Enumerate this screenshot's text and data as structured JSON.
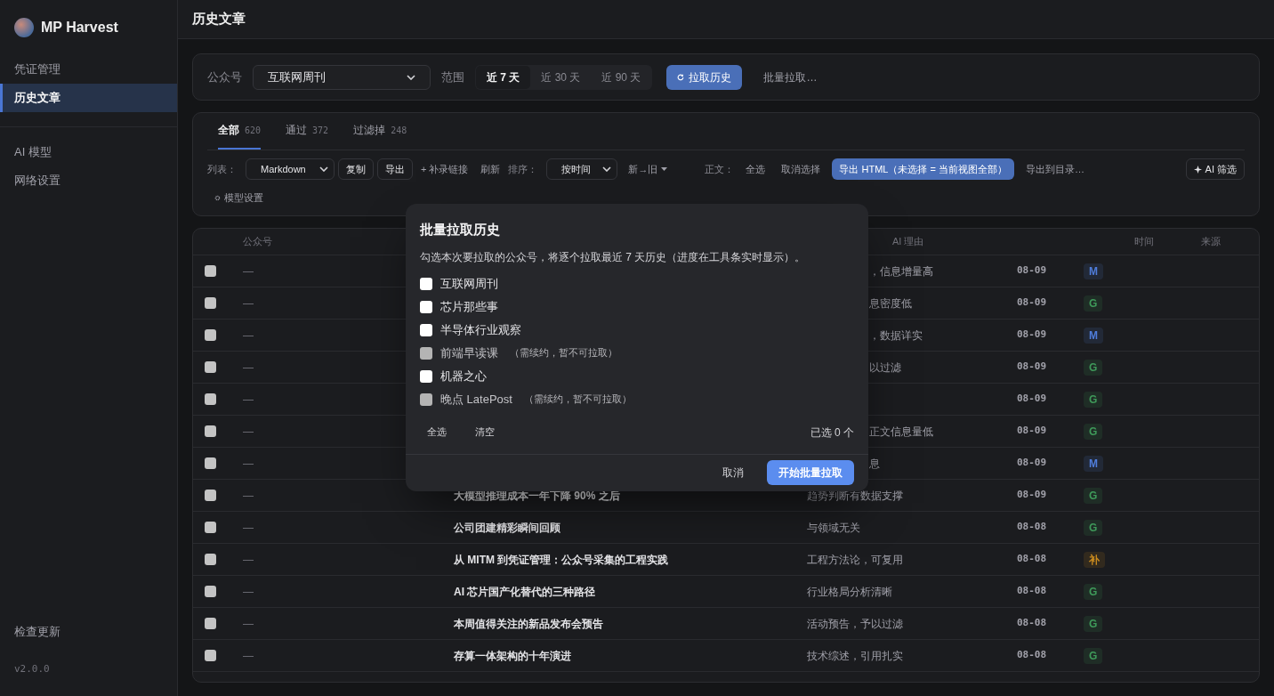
{
  "app": {
    "name": "MP Harvest",
    "version": "v2.0.0"
  },
  "sidebar": {
    "groups": [
      {
        "items": [
          {
            "label": "凭证管理",
            "selected": false
          },
          {
            "label": "历史文章",
            "selected": true
          }
        ]
      },
      {
        "items": [
          {
            "label": "AI 模型",
            "selected": false
          },
          {
            "label": "网络设置",
            "selected": false
          }
        ]
      }
    ],
    "footer_link": "检查更新"
  },
  "page_title": "历史文章",
  "fetch_bar": {
    "account_label": "公众号",
    "account_value": "互联网周刊",
    "range_label": "范围",
    "ranges": [
      {
        "label": "近 7 天",
        "selected": true
      },
      {
        "label": "近 30 天",
        "selected": false
      },
      {
        "label": "近 90 天",
        "selected": false
      }
    ],
    "fetch_button": "拉取历史",
    "batch_link": "批量拉取…"
  },
  "tabs": [
    {
      "label": "全部",
      "count": "620",
      "selected": true
    },
    {
      "label": "通过",
      "count": "372",
      "selected": false
    },
    {
      "label": "过滤掉",
      "count": "248",
      "selected": false
    }
  ],
  "toolbar": {
    "list_label": "列表：",
    "format": "Markdown",
    "copy": "复制",
    "export": "导出",
    "add_link": "+ 补录链接",
    "refresh": "刷新",
    "sort_label": "排序：",
    "sort_value": "按时间",
    "order": "新→旧",
    "body_label": "正文：",
    "select_all": "全选",
    "deselect": "取消选择",
    "export_html": "导出 HTML（未选择 = 当前视图全部）",
    "export_dir": "导出到目录…",
    "ai_filter": "AI 筛选",
    "model_settings": "模型设置"
  },
  "table": {
    "columns": [
      "公众号",
      "AI 理由",
      "时间",
      "来源"
    ],
    "rows": [
      {
        "checked": false,
        "account": "—",
        "reason": "，信息增量高",
        "time": "08-09",
        "source": {
          "label": "M",
          "color": "#4f7ddb"
        }
      },
      {
        "checked": false,
        "account": "—",
        "reason": "息密度低",
        "time": "08-09",
        "source": {
          "label": "G",
          "color": "#3f9a5a"
        }
      },
      {
        "checked": false,
        "account": "—",
        "reason": "，数据详实",
        "time": "08-09",
        "source": {
          "label": "M",
          "color": "#4f7ddb"
        }
      },
      {
        "checked": false,
        "account": "—",
        "reason": "以过滤",
        "time": "08-09",
        "source": {
          "label": "G",
          "color": "#3f9a5a"
        }
      },
      {
        "checked": false,
        "account": "—",
        "time": "08-09",
        "source": {
          "label": "G",
          "color": "#3f9a5a"
        }
      },
      {
        "checked": false,
        "account": "—",
        "reason": "正文信息量低",
        "time": "08-09",
        "source": {
          "label": "G",
          "color": "#3f9a5a"
        }
      },
      {
        "checked": false,
        "account": "—",
        "reason": "息",
        "time": "08-09",
        "source": {
          "label": "M",
          "color": "#4f7ddb"
        }
      },
      {
        "checked": false,
        "account": "—",
        "title": "大模型推理成本一年下降 90% 之后",
        "reason": "趋势判断有数据支撑",
        "time": "08-09",
        "source": {
          "label": "G",
          "color": "#3f9a5a"
        }
      },
      {
        "checked": false,
        "account": "—",
        "title": "公司团建精彩瞬间回顾",
        "reason": "与领域无关",
        "time": "08-08",
        "source": {
          "label": "G",
          "color": "#3f9a5a"
        }
      },
      {
        "checked": false,
        "account": "—",
        "title": "从 MITM 到凭证管理：公众号采集的工程实践",
        "reason": "工程方法论，可复用",
        "time": "08-08",
        "source": {
          "label": "补",
          "color": "#c98a1e"
        }
      },
      {
        "checked": false,
        "account": "—",
        "title": "AI 芯片国产化替代的三种路径",
        "reason": "行业格局分析清晰",
        "time": "08-08",
        "source": {
          "label": "G",
          "color": "#3f9a5a"
        }
      },
      {
        "checked": false,
        "account": "—",
        "title": "本周值得关注的新品发布会预告",
        "reason": "活动预告，予以过滤",
        "time": "08-08",
        "source": {
          "label": "G",
          "color": "#3f9a5a"
        }
      },
      {
        "checked": false,
        "account": "—",
        "title": "存算一体架构的十年演进",
        "reason": "技术综述，引用扎实",
        "time": "08-08",
        "source": {
          "label": "G",
          "color": "#3f9a5a"
        }
      }
    ]
  },
  "dialog": {
    "title": "批量拉取历史",
    "description": "勾选本次要拉取的公众号，将逐个拉取最近 7 天历史（进度在工具条实时显示）。",
    "accounts": [
      {
        "name": "互联网周刊",
        "checked": false,
        "disabled": false
      },
      {
        "name": "芯片那些事",
        "checked": false,
        "disabled": false
      },
      {
        "name": "半导体行业观察",
        "checked": false,
        "disabled": false
      },
      {
        "name": "前端早读课",
        "note": "（需续约，暂不可拉取）",
        "checked": false,
        "disabled": true
      },
      {
        "name": "机器之心",
        "checked": false,
        "disabled": false
      },
      {
        "name": "晚点 LatePost",
        "note": "（需续约，暂不可拉取）",
        "checked": false,
        "disabled": true
      }
    ],
    "select_all": "全选",
    "clear": "清空",
    "count": "已选 0 个",
    "cancel": "取消",
    "start": "开始批量拉取"
  }
}
